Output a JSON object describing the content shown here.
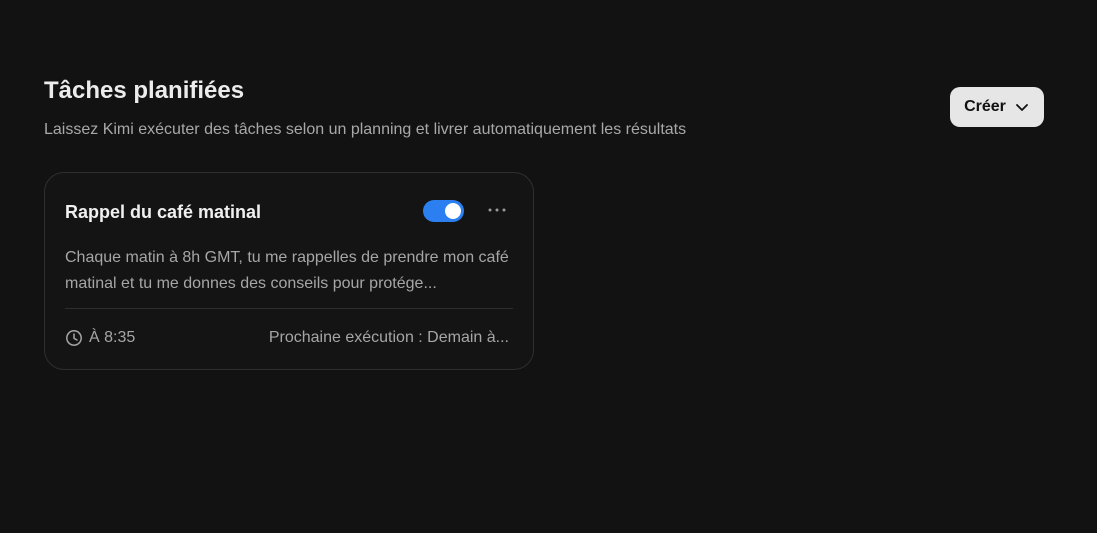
{
  "header": {
    "title": "Tâches planifiées",
    "subtitle": "Laissez Kimi exécuter des tâches selon un planning et livrer automatiquement les résultats",
    "create_label": "Créer",
    "create_icon": "chevron-down-icon"
  },
  "tasks": [
    {
      "title": "Rappel du café matinal",
      "enabled": true,
      "description": "Chaque matin à 8h GMT, tu me rappelles de prendre mon café matinal et tu me donnes des conseils pour protége...",
      "time": "À 8:35",
      "next_run": "Prochaine exécution : Demain à...",
      "time_icon": "clock-icon",
      "menu_icon": "more-horizontal-icon"
    }
  ],
  "colors": {
    "background": "#121212",
    "accent": "#2b7ff0",
    "button_bg": "#e6e6e6"
  }
}
